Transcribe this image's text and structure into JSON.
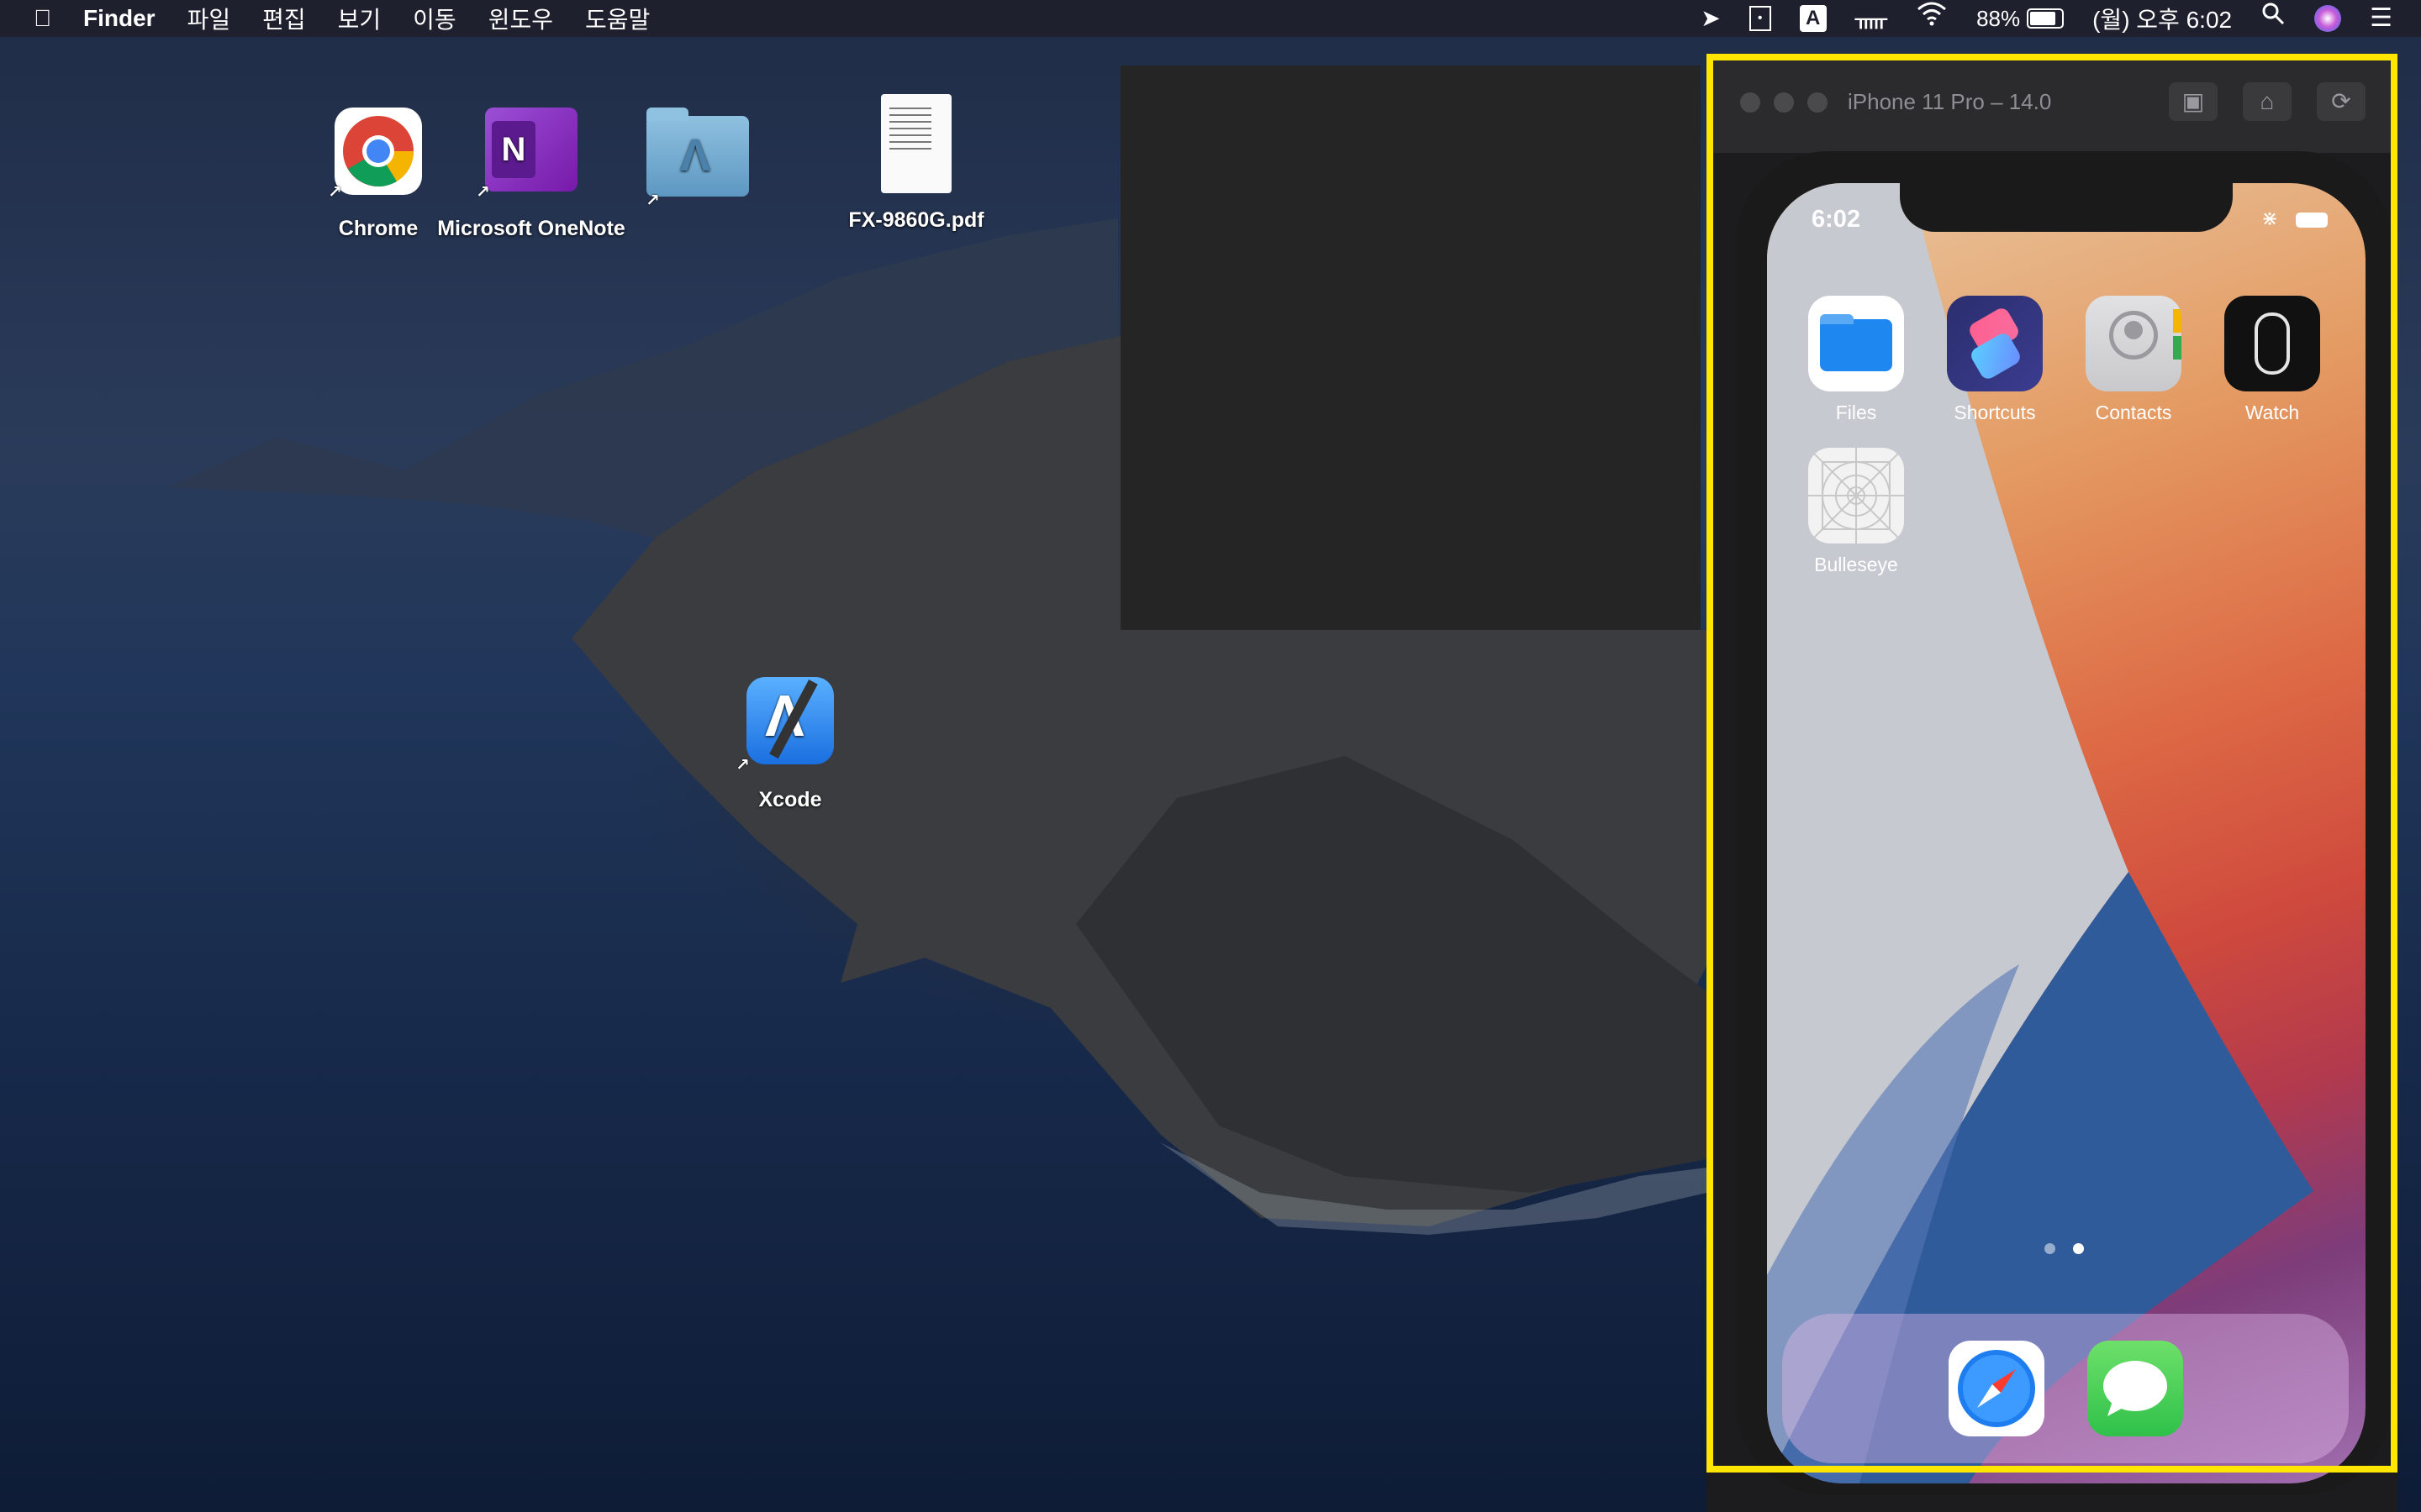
{
  "menubar": {
    "apple": "",
    "app_name": "Finder",
    "menus": [
      "파일",
      "편집",
      "보기",
      "이동",
      "윈도우",
      "도움말"
    ],
    "battery_percent": "88%",
    "clock": "(월) 오후 6:02",
    "input_source": "A"
  },
  "desktop": {
    "icons": [
      {
        "label": "Chrome"
      },
      {
        "label": "Microsoft OneNote"
      },
      {
        "label": ""
      },
      {
        "label": "FX-9860G.pdf"
      },
      {
        "label": "Xcode"
      }
    ]
  },
  "simulator": {
    "title": "iPhone 11 Pro – 14.0",
    "toolbar": [
      "screenshot-icon",
      "home-icon",
      "rotate-icon"
    ]
  },
  "phone": {
    "time": "6:02",
    "apps": [
      {
        "label": "Files",
        "color": "#1e88f0"
      },
      {
        "label": "Shortcuts",
        "color": "#3b3c8f"
      },
      {
        "label": "Contacts",
        "color": "#c9c9cc"
      },
      {
        "label": "Watch",
        "color": "#111111"
      },
      {
        "label": "Bulleseye",
        "color": "#f2f2f2"
      }
    ],
    "dock": [
      "safari-icon",
      "messages-icon"
    ],
    "page_dots": 2,
    "active_page": 2
  },
  "colors": {
    "highlight": "#ffe600",
    "menubar": "#1e202c"
  }
}
